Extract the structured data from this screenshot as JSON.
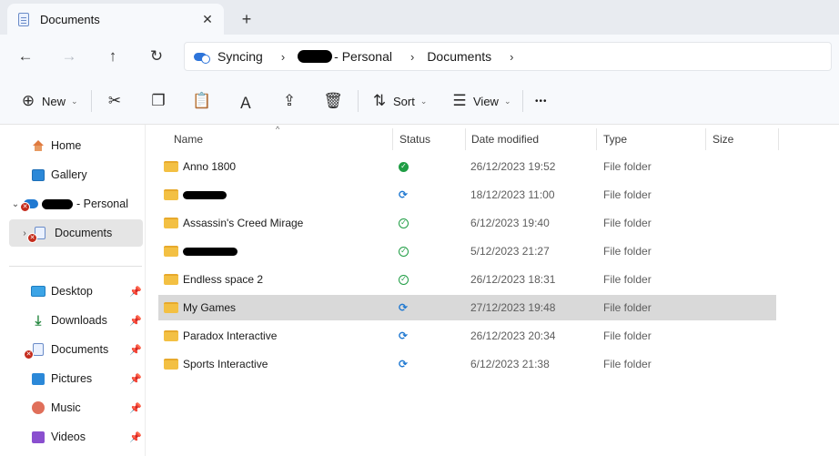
{
  "tab": {
    "title": "Documents",
    "close_glyph": "✕",
    "add_glyph": "+"
  },
  "nav": {
    "back_glyph": "←",
    "forward_glyph": "→",
    "up_glyph": "↑",
    "refresh_glyph": "↻"
  },
  "address": {
    "crumbs": [
      "Syncing",
      "- Personal",
      "Documents"
    ],
    "separator": "›"
  },
  "toolbar": {
    "new_label": "New",
    "sort_label": "Sort",
    "view_label": "View",
    "more_glyph": "•••",
    "chevron_glyph": "⌄",
    "cut_glyph": "✂",
    "copy_glyph": "❐",
    "paste_glyph": "📋",
    "rename_glyph": "Ａ",
    "share_glyph": "⇪",
    "delete_glyph": "🗑",
    "plus_glyph": "⊕",
    "sort_glyph": "⇅",
    "view_glyph": "☰"
  },
  "sidebar": {
    "items": [
      {
        "label": "Home",
        "icon": "home-icon"
      },
      {
        "label": "Gallery",
        "icon": "gallery-icon"
      },
      {
        "label": "- Personal",
        "icon": "onedrive-icon"
      },
      {
        "label": "Documents",
        "icon": "documents-icon"
      },
      {
        "label": "Desktop",
        "icon": "desktop-icon"
      },
      {
        "label": "Downloads",
        "icon": "downloads-icon"
      },
      {
        "label": "Documents",
        "icon": "documents-icon"
      },
      {
        "label": "Pictures",
        "icon": "pictures-icon"
      },
      {
        "label": "Music",
        "icon": "music-icon"
      },
      {
        "label": "Videos",
        "icon": "videos-icon"
      }
    ],
    "expand_open_glyph": "⌄",
    "expand_closed_glyph": "›",
    "pin_glyph": "📌",
    "error_glyph": "✕",
    "downloads_glyph": "⤓"
  },
  "columns": {
    "name": "Name",
    "status": "Status",
    "date": "Date modified",
    "type": "Type",
    "size": "Size",
    "sort_glyph": "^"
  },
  "rows": [
    {
      "name": "Anno 1800",
      "status": "synced-filled",
      "date": "26/12/2023 19:52",
      "type": "File folder"
    },
    {
      "name": "",
      "status": "syncing",
      "date": "18/12/2023 11:00",
      "type": "File folder"
    },
    {
      "name": "Assassin's Creed Mirage",
      "status": "synced",
      "date": "6/12/2023 19:40",
      "type": "File folder"
    },
    {
      "name": "",
      "status": "synced",
      "date": "5/12/2023 21:27",
      "type": "File folder"
    },
    {
      "name": "Endless space 2",
      "status": "synced",
      "date": "26/12/2023 18:31",
      "type": "File folder"
    },
    {
      "name": "My Games",
      "status": "syncing",
      "date": "27/12/2023 19:48",
      "type": "File folder",
      "selected": true
    },
    {
      "name": "Paradox Interactive",
      "status": "syncing",
      "date": "26/12/2023 20:34",
      "type": "File folder"
    },
    {
      "name": "Sports Interactive",
      "status": "syncing",
      "date": "6/12/2023 21:38",
      "type": "File folder"
    }
  ],
  "status_glyphs": {
    "ok": "✓",
    "sync": "⟳"
  },
  "colors": {
    "accent": "#1f78d1",
    "synced": "#1f9d44",
    "error": "#c42b1c",
    "folder": "#f3c043"
  }
}
